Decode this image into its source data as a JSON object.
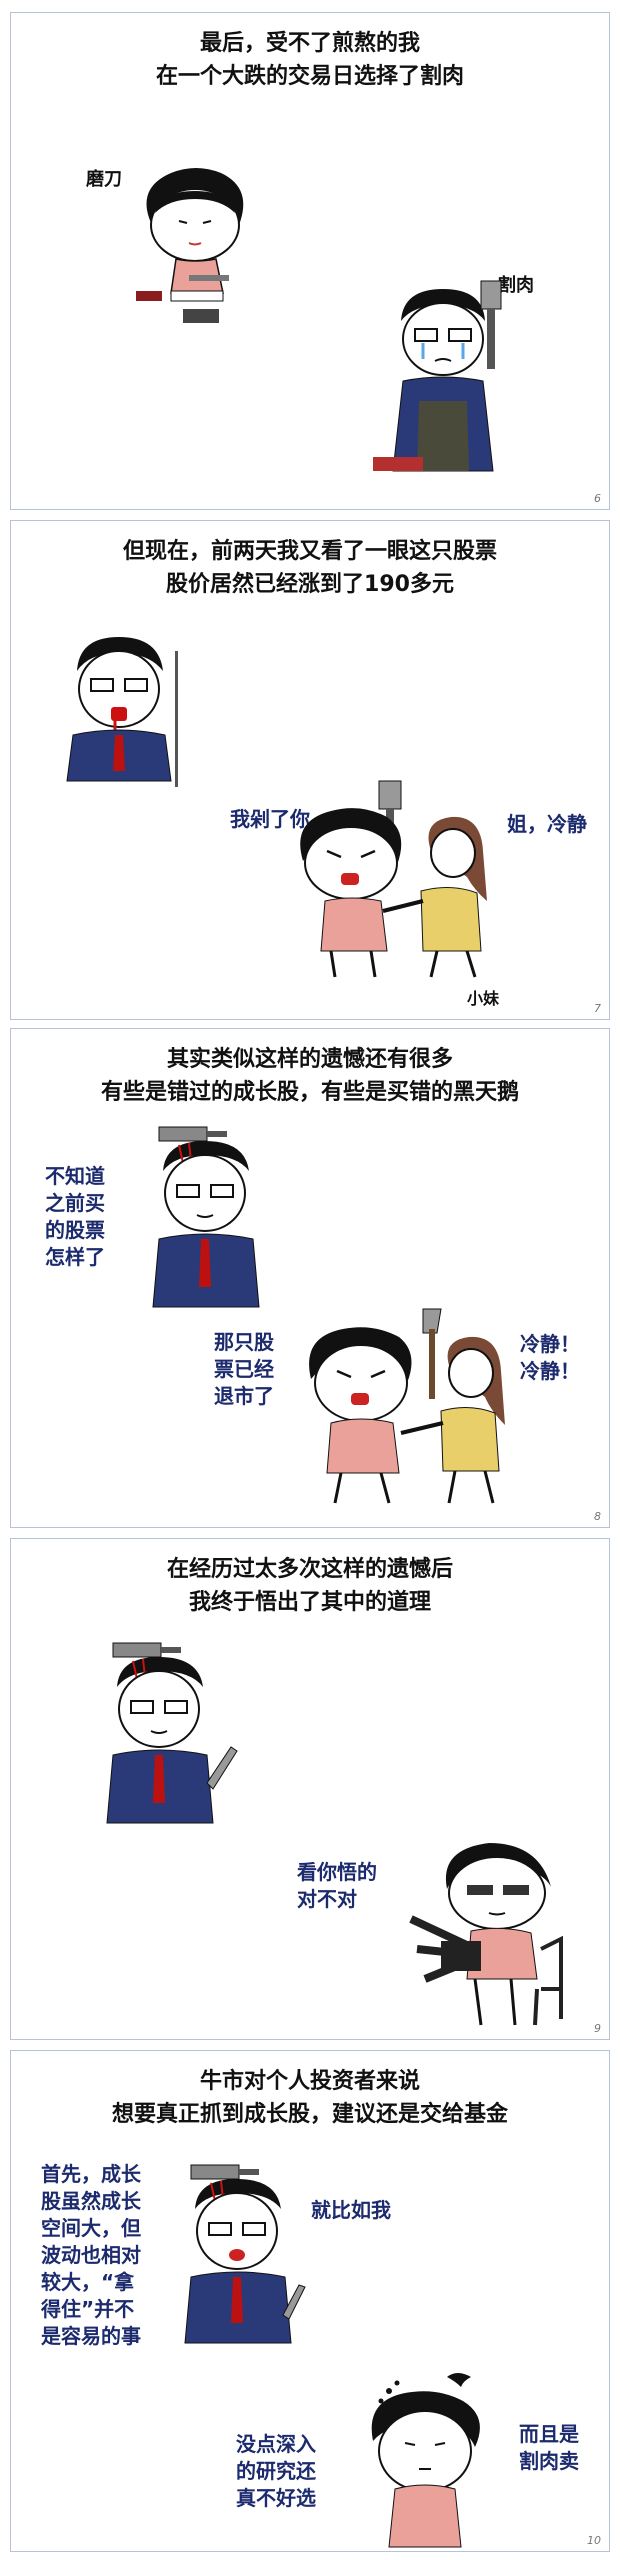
{
  "panels": [
    {
      "title_lines": [
        "最后，受不了煎熬的我",
        "在一个大跌的交易日选择了割肉"
      ],
      "labels": [
        "磨刀",
        "割肉"
      ],
      "page_number": "6"
    },
    {
      "title_lines": [
        "但现在，前两天我又看了一眼这只股票",
        "股价居然已经涨到了190多元"
      ],
      "speech_left": [
        "我剁了你"
      ],
      "speech_right": [
        "姐，冷静"
      ],
      "label_sister": "小妹",
      "page_number": "7"
    },
    {
      "title_lines": [
        "其实类似这样的遗憾还有很多",
        "有些是错过的成长股，有些是买错的黑天鹅"
      ],
      "speech_man": [
        "不知道",
        "之前买",
        "的股票",
        "怎样了"
      ],
      "speech_girl": [
        "那只股",
        "票已经",
        "退市了"
      ],
      "speech_sister": [
        "冷静！",
        "冷静！"
      ],
      "page_number": "8"
    },
    {
      "title_lines": [
        "在经历过太多次这样的遗憾后",
        "我终于悟出了其中的道理"
      ],
      "speech_girl": [
        "看你悟的",
        "对不对"
      ],
      "page_number": "9"
    },
    {
      "title_lines": [
        "牛市对个人投资者来说",
        "想要真正抓到成长股，建议还是交给基金"
      ],
      "speech_man": [
        "首先，成长",
        "股虽然成长",
        "空间大，但",
        "波动也相对",
        "较大，“拿",
        "得住”并不",
        "是容易的事"
      ],
      "speech_right_top": [
        "就比如我"
      ],
      "speech_girl": [
        "没点深入",
        "的研究还",
        "真不好选"
      ],
      "speech_right_bottom": [
        "而且是",
        "割肉卖"
      ],
      "page_number": "10"
    }
  ]
}
